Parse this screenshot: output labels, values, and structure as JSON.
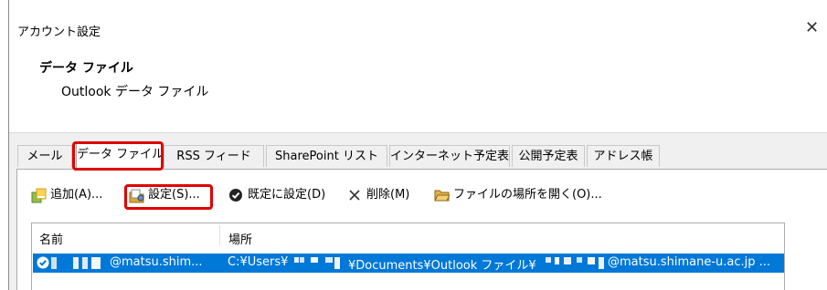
{
  "window": {
    "title": "アカウント設定",
    "close_glyph": "✕"
  },
  "header": {
    "title": "データ ファイル",
    "subtitle": "Outlook データ ファイル"
  },
  "tabs": [
    {
      "label": "メール"
    },
    {
      "label": "データ ファイル",
      "active": true
    },
    {
      "label": "RSS フィード"
    },
    {
      "label": "SharePoint リスト"
    },
    {
      "label": "インターネット予定表"
    },
    {
      "label": "公開予定表"
    },
    {
      "label": "アドレス帳"
    }
  ],
  "toolbar": {
    "add": {
      "label": "追加(A)...",
      "icon": "add-data-file-icon"
    },
    "settings": {
      "label": "設定(S)...",
      "icon": "settings-folder-icon"
    },
    "set_default": {
      "label": "既定に設定(D)",
      "icon": "checkmark-circle-icon"
    },
    "delete": {
      "label": "削除(M)",
      "icon": "delete-x-icon"
    },
    "open_location": {
      "label": "ファイルの場所を開く(O)...",
      "icon": "open-folder-icon"
    }
  },
  "list": {
    "columns": {
      "name": "名前",
      "location": "場所"
    },
    "rows": [
      {
        "name": "@matsu.shim...",
        "location_a": "C:¥Users¥",
        "location_b": "¥Documents¥Outlook ファイル¥",
        "location_c": "@matsu.shimane-u.ac.jp ...",
        "selected": true,
        "is_default": true
      }
    ]
  },
  "colors": {
    "highlight_box": "#e00000",
    "selection": "#0078d7",
    "dialog_bg": "#f0f0f0"
  }
}
